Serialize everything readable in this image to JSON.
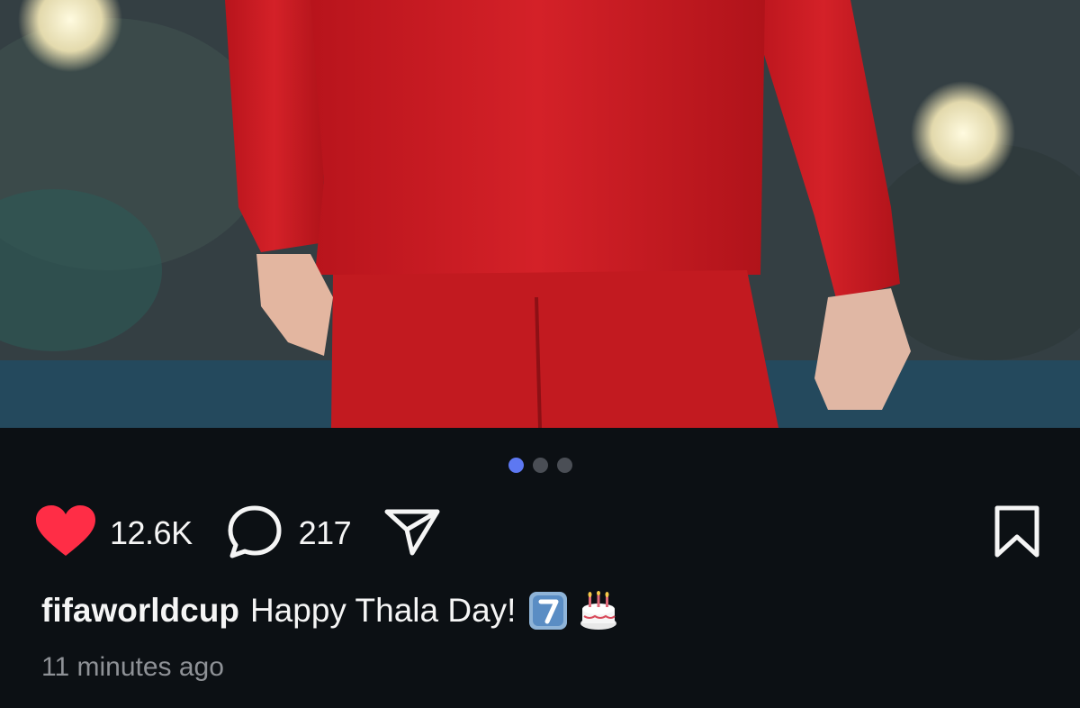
{
  "post": {
    "carousel": {
      "total": 3,
      "active_index": 0
    },
    "actions": {
      "like_count": "12.6K",
      "comment_count": "217"
    },
    "caption": {
      "username": "fifaworldcup",
      "text": "Happy Thala Day!"
    },
    "timestamp": "11 minutes ago",
    "colors": {
      "background": "#0c1014",
      "like_active": "#ff2d46",
      "dot_active": "#5d78f2",
      "dot_inactive": "#4a4e55",
      "text_secondary": "#8e9196"
    },
    "icons": [
      "heart-icon",
      "comment-icon",
      "share-icon",
      "bookmark-icon",
      "keycap-seven-emoji",
      "birthday-cake-emoji"
    ]
  }
}
